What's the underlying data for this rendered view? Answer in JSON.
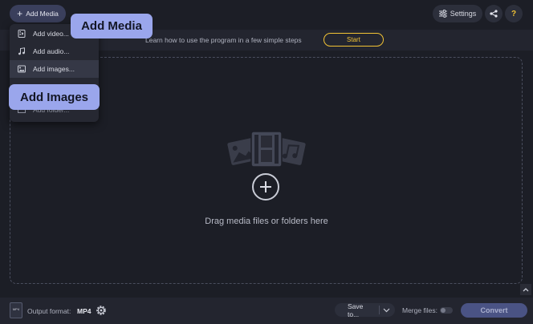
{
  "header": {
    "add_media_label": "Add Media",
    "settings_label": "Settings",
    "help_label": "?"
  },
  "tip": {
    "text": "Learn how to use the program in a few simple steps",
    "start_label": "Start"
  },
  "menu": {
    "items": [
      {
        "label": "Add video...",
        "icon": "video-file-icon"
      },
      {
        "label": "Add audio...",
        "icon": "music-note-icon"
      },
      {
        "label": "Add images...",
        "icon": "image-file-icon"
      },
      {
        "label": "Add folder...",
        "icon": "folder-icon"
      }
    ]
  },
  "callouts": {
    "add_media": "Add Media",
    "add_images": "Add Images"
  },
  "dropzone": {
    "text": "Drag media files or folders here"
  },
  "bottom": {
    "output_format_label": "Output format:",
    "output_format_value": "MP4",
    "format_icon_text": "MP4",
    "save_label": "Save to...",
    "merge_label": "Merge files:",
    "merge_enabled": false,
    "convert_label": "Convert"
  },
  "colors": {
    "background": "#1c1e26",
    "accent_yellow": "#f2c335",
    "callout": "#9aa6ec",
    "convert_button": "#4a5384"
  }
}
